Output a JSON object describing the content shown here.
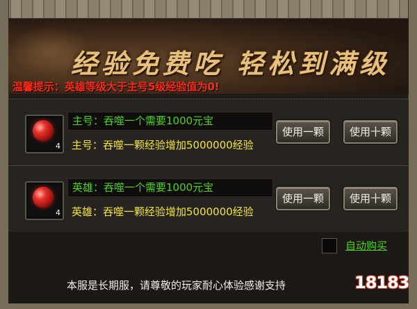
{
  "banner": {
    "title": "经验免费吃  轻松到满级"
  },
  "tip": "温馨提示：英雄等级大于主号5级经验值为0!",
  "rows": [
    {
      "gem_count": "4",
      "cost_text": "主号：吞噬一个需要1000元宝",
      "gain_text": "主号：吞噬一颗经验增加5000000经验",
      "use_one_label": "使用一颗",
      "use_ten_label": "使用十颗"
    },
    {
      "gem_count": "4",
      "cost_text": "英雄：吞噬一个需要1000元宝",
      "gain_text": "英雄：吞噬一颗经验增加5000000经验",
      "use_one_label": "使用一颗",
      "use_ten_label": "使用十颗"
    }
  ],
  "auto_buy": {
    "label": "自动购买",
    "checked": false
  },
  "notice": "本服是长期服，请尊敬的玩家耐心体验感谢支持",
  "watermark": "18183",
  "colors": {
    "green_text": "#4fd31f",
    "yellow_text": "#f2e53a",
    "tip_red": "#ff2b1a",
    "title_gold": "#e7c07c"
  }
}
